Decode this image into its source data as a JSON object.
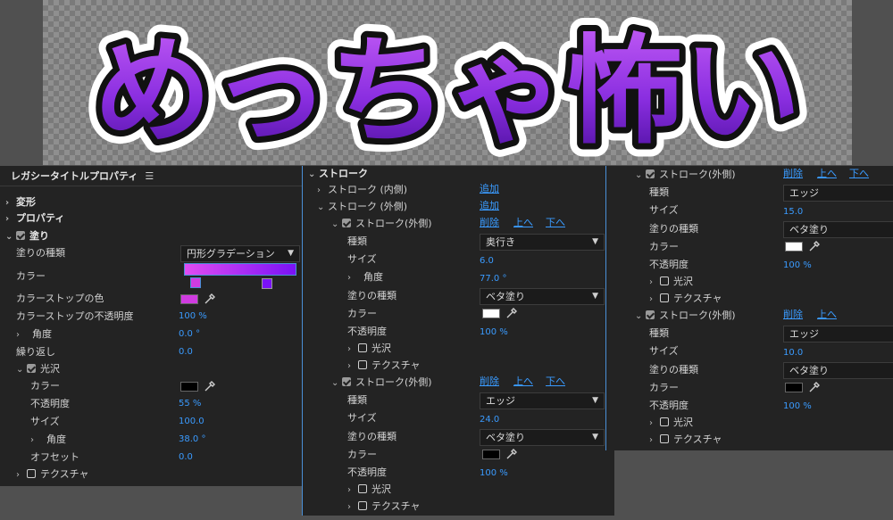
{
  "preview": {
    "text": "めっちゃ怖い",
    "fill_top": "#b14cf0",
    "fill_bottom": "#5a14b0",
    "inner_stroke": "#111111",
    "outer_stroke": "#ffffff"
  },
  "panel1": {
    "title": "レガシータイトルプロパティ",
    "transform": "変形",
    "properties": "プロパティ",
    "fill": "塗り",
    "fill_type_label": "塗りの種類",
    "fill_type_value": "円形グラデーション",
    "color_label": "カラー",
    "gradient": {
      "from": "#e14cf2",
      "to": "#7a12f5"
    },
    "stop_color_label": "カラーストップの色",
    "stop_color": "#d03be0",
    "stop_opacity_label": "カラーストップの不透明度",
    "stop_opacity": "100 %",
    "angle_label": "角度",
    "angle_value": "0.0 °",
    "repeat_label": "繰り返し",
    "repeat_value": "0.0",
    "sheen_label": "光沢",
    "sheen_color_label": "カラー",
    "sheen_color": "#000000",
    "sheen_opacity_label": "不透明度",
    "sheen_opacity": "55 %",
    "sheen_size_label": "サイズ",
    "sheen_size": "100.0",
    "sheen_angle_label": "角度",
    "sheen_angle": "38.0 °",
    "sheen_offset_label": "オフセット",
    "sheen_offset": "0.0",
    "texture_label": "テクスチャ"
  },
  "panel2": {
    "stroke_header": "ストローク",
    "inner_stroke": "ストローク (内側)",
    "outer_stroke": "ストローク (外側)",
    "add": "追加",
    "s1": {
      "title": "ストローク(外側)",
      "delete": "削除",
      "up": "上へ",
      "down": "下へ",
      "type_label": "種類",
      "type_value": "奥行き",
      "size_label": "サイズ",
      "size_value": "6.0",
      "angle_label": "角度",
      "angle_value": "77.0 °",
      "fill_type_label": "塗りの種類",
      "fill_type_value": "ベタ塗り",
      "color_label": "カラー",
      "color": "#ffffff",
      "opacity_label": "不透明度",
      "opacity_value": "100 %",
      "sheen_label": "光沢",
      "texture_label": "テクスチャ"
    },
    "s2": {
      "title": "ストローク(外側)",
      "delete": "削除",
      "up": "上へ",
      "down": "下へ",
      "type_label": "種類",
      "type_value": "エッジ",
      "size_label": "サイズ",
      "size_value": "24.0",
      "fill_type_label": "塗りの種類",
      "fill_type_value": "ベタ塗り",
      "color_label": "カラー",
      "color": "#000000",
      "opacity_label": "不透明度",
      "opacity_value": "100 %",
      "sheen_label": "光沢",
      "texture_label": "テクスチャ"
    }
  },
  "panel3": {
    "s1": {
      "title": "ストローク(外側)",
      "delete": "削除",
      "up": "上へ",
      "down": "下へ",
      "type_label": "種類",
      "type_value": "エッジ",
      "size_label": "サイズ",
      "size_value": "15.0",
      "fill_type_label": "塗りの種類",
      "fill_type_value": "ベタ塗り",
      "color_label": "カラー",
      "color": "#ffffff",
      "opacity_label": "不透明度",
      "opacity_value": "100 %",
      "sheen_label": "光沢",
      "texture_label": "テクスチャ"
    },
    "s2": {
      "title": "ストローク(外側)",
      "delete": "削除",
      "up": "上へ",
      "type_label": "種類",
      "type_value": "エッジ",
      "size_label": "サイズ",
      "size_value": "10.0",
      "fill_type_label": "塗りの種類",
      "fill_type_value": "ベタ塗り",
      "color_label": "カラー",
      "color": "#000000",
      "opacity_label": "不透明度",
      "opacity_value": "100 %",
      "sheen_label": "光沢",
      "texture_label": "テクスチャ"
    }
  }
}
